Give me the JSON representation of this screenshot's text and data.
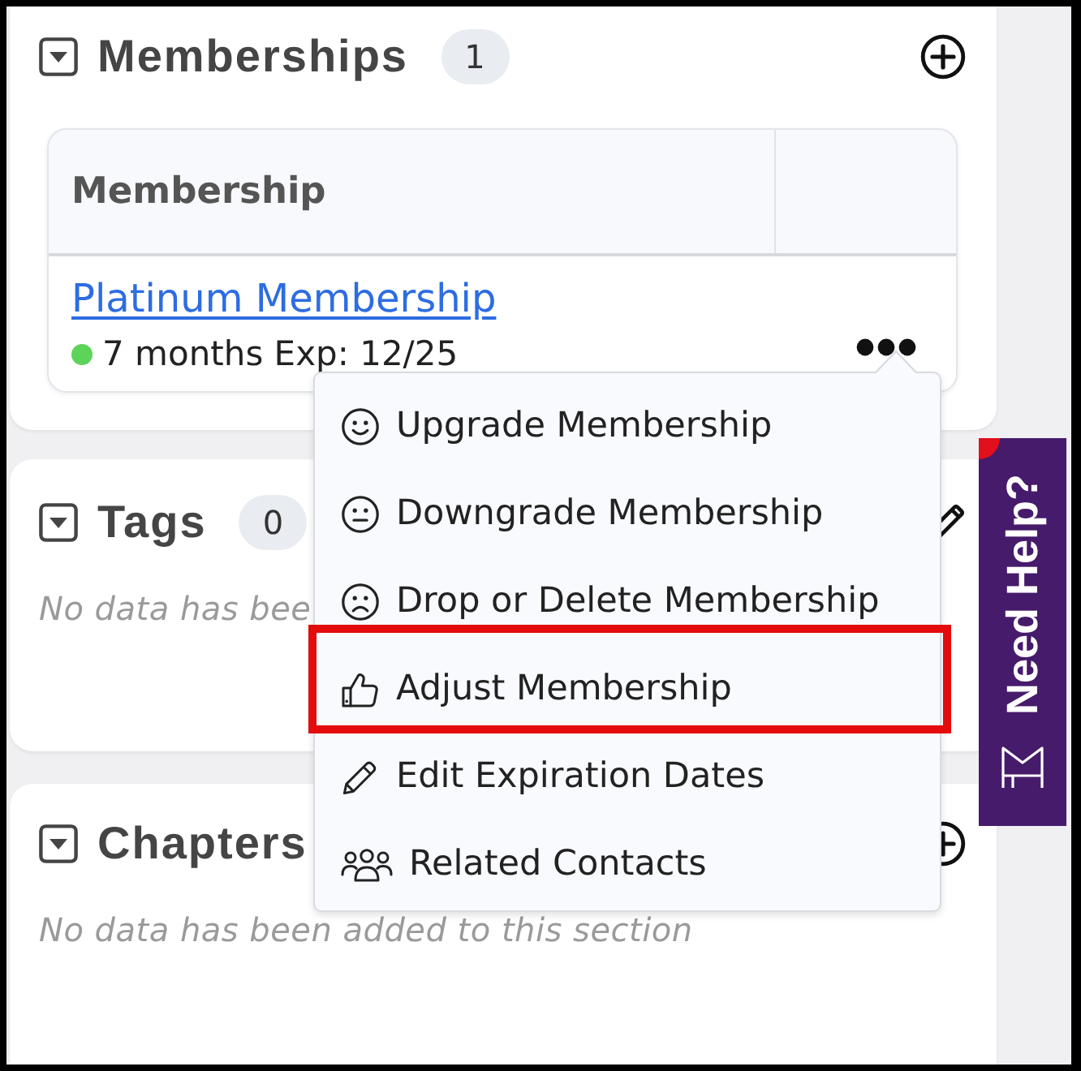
{
  "memberships": {
    "title": "Memberships",
    "count": "1",
    "expanded": true,
    "table": {
      "columns": [
        "Membership"
      ],
      "rows": [
        {
          "name": "Platinum Membership",
          "color": "#5cd45a",
          "status": "7 months Exp: 12/25"
        }
      ]
    }
  },
  "tags": {
    "title": "Tags",
    "count": "0",
    "expanded": true,
    "empty_text": "No data has bee"
  },
  "chapters": {
    "title": "Chapters",
    "expanded": true,
    "empty_text": "No data has been added to this section"
  },
  "row_menu": {
    "open": true,
    "items": [
      {
        "label": "Upgrade Membership",
        "highlighted": false
      },
      {
        "label": "Downgrade Membership",
        "highlighted": false
      },
      {
        "label": "Drop or Delete Membership",
        "highlighted": false
      },
      {
        "label": "Adjust Membership",
        "highlighted": true
      },
      {
        "label": "Edit Expiration Dates",
        "highlighted": false
      },
      {
        "label": "Related Contacts",
        "highlighted": false
      }
    ]
  },
  "need_help": {
    "label": "Need Help?",
    "notification": true
  }
}
